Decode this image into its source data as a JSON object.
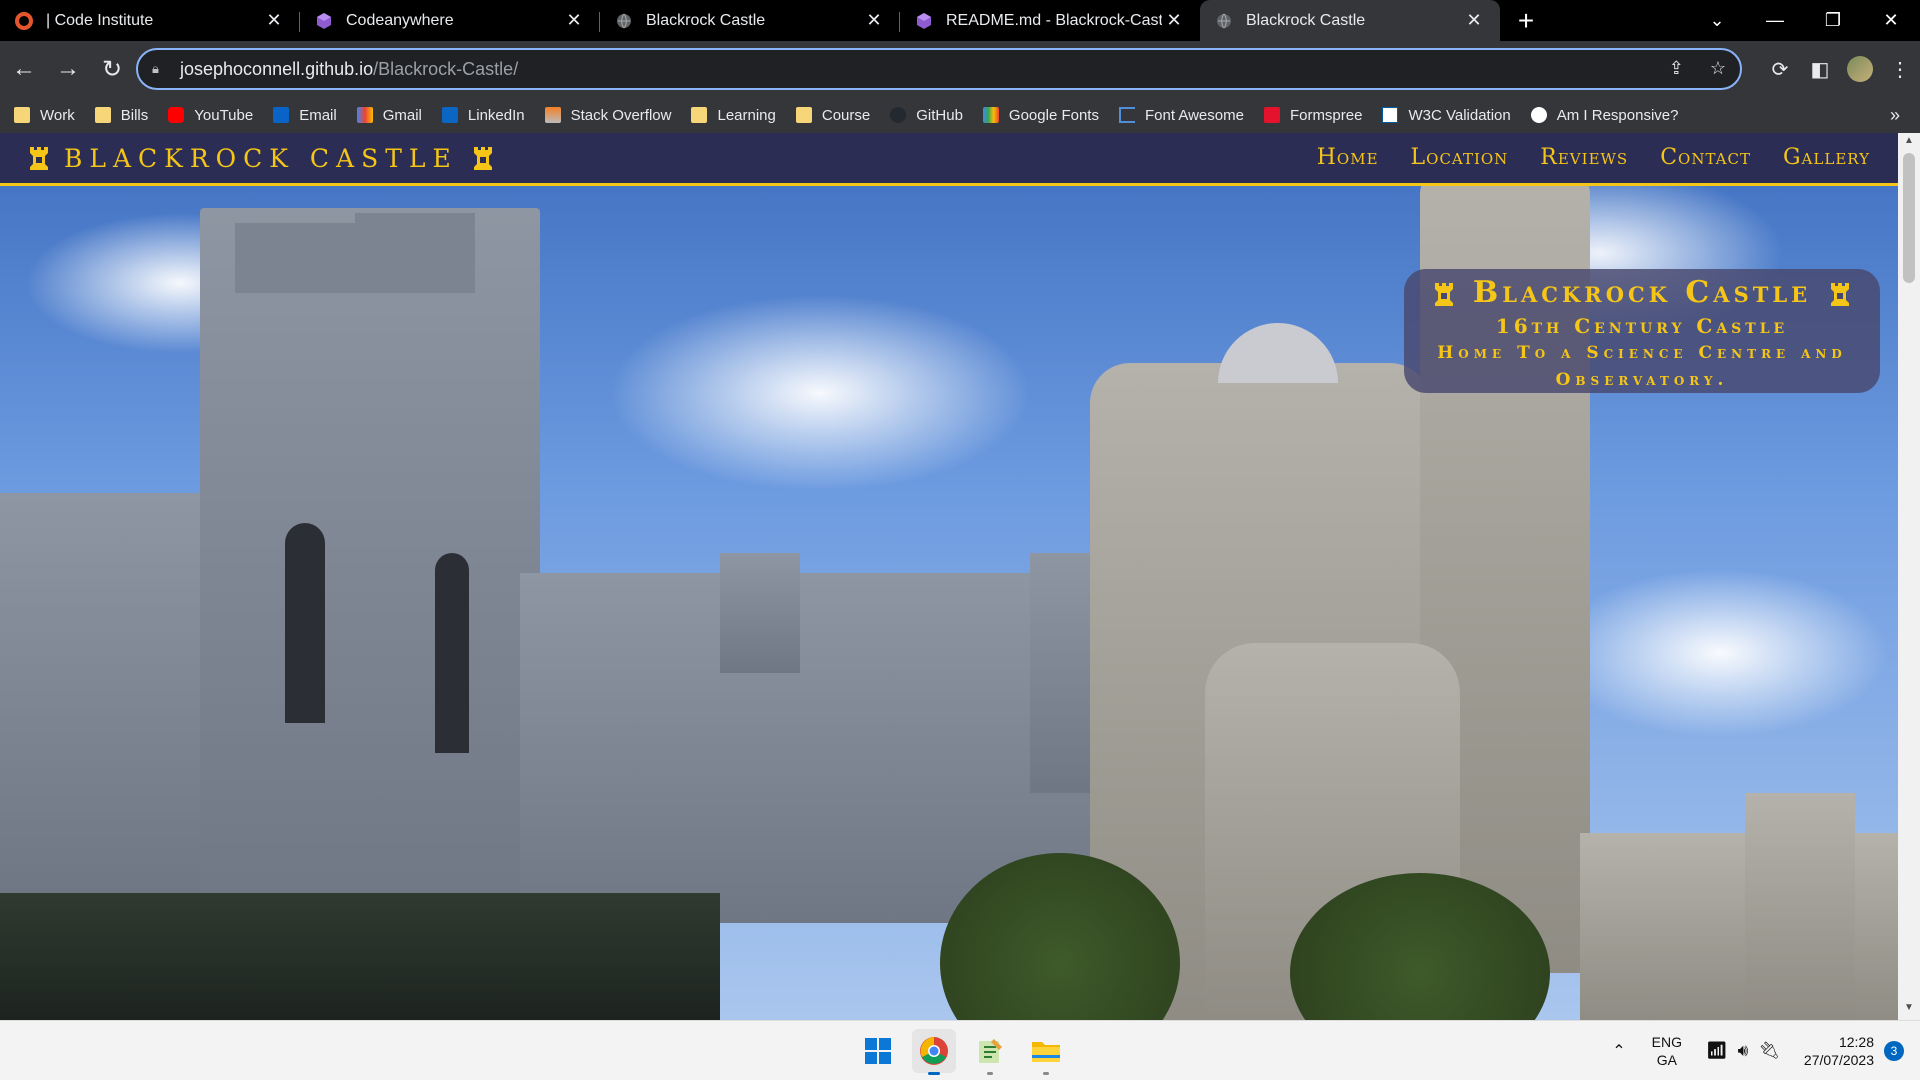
{
  "browser": {
    "tabs": [
      {
        "title": "| Code Institute",
        "icon": "code-institute-icon"
      },
      {
        "title": "Codeanywhere",
        "icon": "codeanywhere-icon"
      },
      {
        "title": "Blackrock Castle",
        "icon": "globe-icon"
      },
      {
        "title": "README.md - Blackrock-Castle -",
        "icon": "codeanywhere-icon"
      },
      {
        "title": "Blackrock Castle",
        "icon": "globe-icon"
      }
    ],
    "address": {
      "host": "josephoconnell.github.io",
      "path": "/Blackrock-Castle/"
    },
    "bookmarks": [
      {
        "label": "Work",
        "icon": "folder-icon"
      },
      {
        "label": "Bills",
        "icon": "folder-icon"
      },
      {
        "label": "YouTube",
        "icon": "youtube-icon"
      },
      {
        "label": "Email",
        "icon": "outlook-icon"
      },
      {
        "label": "Gmail",
        "icon": "gmail-icon"
      },
      {
        "label": "LinkedIn",
        "icon": "linkedin-icon"
      },
      {
        "label": "Stack Overflow",
        "icon": "stackoverflow-icon"
      },
      {
        "label": "Learning",
        "icon": "folder-icon"
      },
      {
        "label": "Course",
        "icon": "folder-icon"
      },
      {
        "label": "GitHub",
        "icon": "github-icon"
      },
      {
        "label": "Google Fonts",
        "icon": "google-fonts-icon"
      },
      {
        "label": "Font Awesome",
        "icon": "flag-icon"
      },
      {
        "label": "Formspree",
        "icon": "formspree-icon"
      },
      {
        "label": "W3C Validation",
        "icon": "w3c-icon"
      },
      {
        "label": "Am I Responsive?",
        "icon": "amiresponsive-icon"
      }
    ]
  },
  "site": {
    "logo": "BLACKROCK CASTLE",
    "nav": [
      "Home",
      "Location",
      "Reviews",
      "Contact",
      "Gallery"
    ],
    "caption": {
      "title": "Blackrock Castle",
      "line2": "16th Century Castle",
      "line3": "Home To a Science Centre and Observatory."
    },
    "accent_color": "#f5c518",
    "header_color": "#2b2d55"
  },
  "taskbar": {
    "language": "ENG",
    "layout": "GA",
    "time": "12:28",
    "date": "27/07/2023",
    "notifications": "3"
  }
}
